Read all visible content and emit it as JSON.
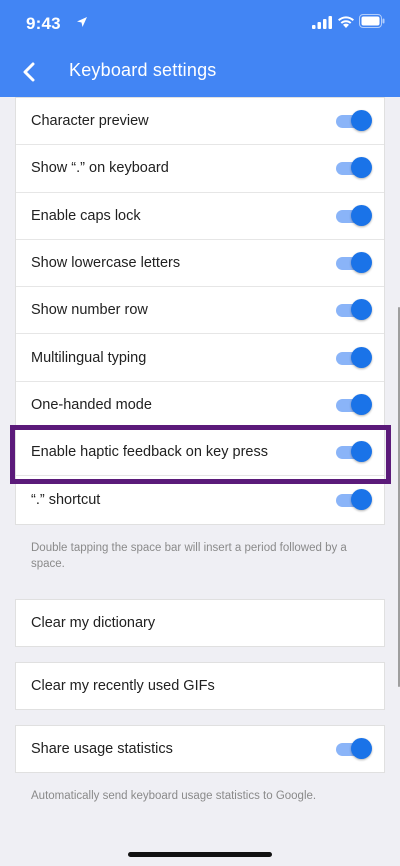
{
  "status_bar": {
    "time": "9:43"
  },
  "app_bar": {
    "title": "Keyboard settings"
  },
  "settings": [
    {
      "label": "Character preview",
      "enabled": true
    },
    {
      "label": "Show “.” on keyboard",
      "enabled": true
    },
    {
      "label": "Enable caps lock",
      "enabled": true
    },
    {
      "label": "Show lowercase letters",
      "enabled": true
    },
    {
      "label": "Show number row",
      "enabled": true
    },
    {
      "label": "Multilingual typing",
      "enabled": true
    },
    {
      "label": "One-handed mode",
      "enabled": true
    },
    {
      "label": "Enable haptic feedback on key press",
      "enabled": true
    },
    {
      "label": "“.” shortcut",
      "enabled": true
    }
  ],
  "shortcut_note": "Double tapping the space bar will insert a period followed by a space.",
  "actions": {
    "clear_dictionary": "Clear my dictionary",
    "clear_gifs": "Clear my recently used GIFs"
  },
  "usage": {
    "label": "Share usage statistics",
    "enabled": true,
    "note": "Automatically send keyboard usage statistics to Google."
  },
  "colors": {
    "header": "#4285f4",
    "toggle_thumb": "#1a73e8",
    "toggle_track": "#8ab4f8",
    "highlight_border": "#5b1a7a",
    "background": "#efeff4"
  }
}
